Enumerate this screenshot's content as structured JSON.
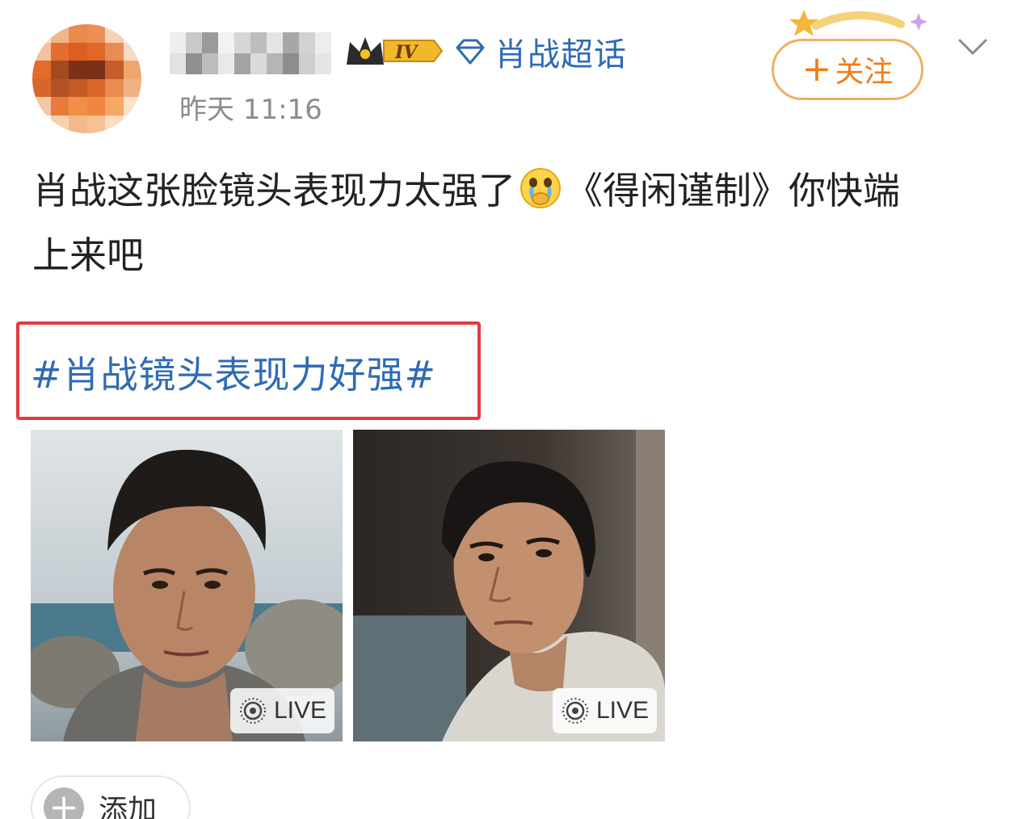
{
  "post": {
    "supertopic_label": "肖战超话",
    "level_badge": "IV",
    "timestamp": "昨天 11:16",
    "follow_label": "关注",
    "follow_plus": "+",
    "body_line1_a": "肖战这张脸镜头表现力太强了",
    "body_line1_b": "《得闲谨制》你快端",
    "body_line2": "上来吧",
    "emoji_icon": "crying-emoji-icon",
    "hashtag": "#肖战镜头表现力好强#",
    "images": [
      {
        "live_label": "LIVE"
      },
      {
        "live_label": "LIVE"
      }
    ],
    "add_label": "添加",
    "add_plus": "+"
  },
  "colors": {
    "link_blue": "#2f6bb3",
    "follow_orange": "#f07d1a",
    "highlight_red": "#e23b40",
    "timestamp_gray": "#8c8c8c"
  }
}
